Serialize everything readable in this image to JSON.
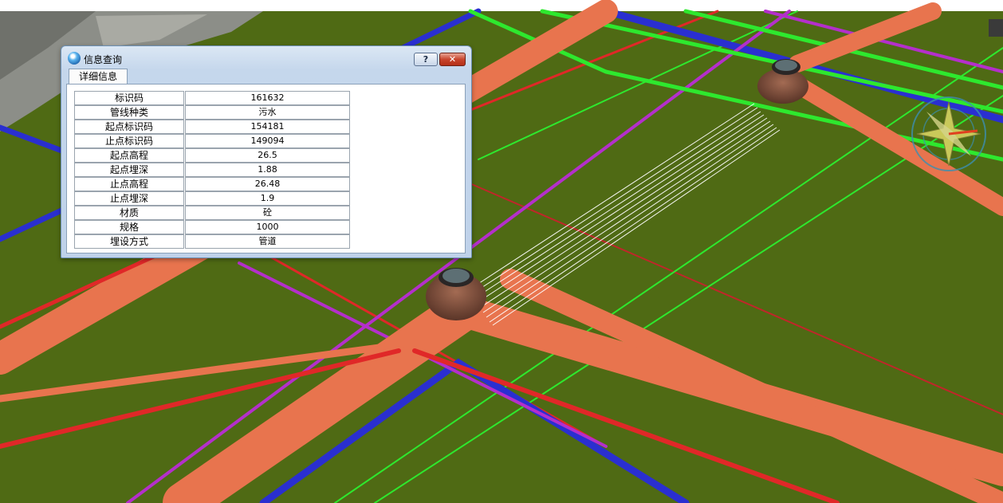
{
  "dialog": {
    "title": "信息查询",
    "help_label": "?",
    "close_label": "✕",
    "tab_label": "详细信息",
    "rows": [
      {
        "key": "标识码",
        "value": "161632"
      },
      {
        "key": "管线种类",
        "value": "污水"
      },
      {
        "key": "起点标识码",
        "value": "154181"
      },
      {
        "key": "止点标识码",
        "value": "149094"
      },
      {
        "key": "起点高程",
        "value": "26.5"
      },
      {
        "key": "起点埋深",
        "value": "1.88"
      },
      {
        "key": "止点高程",
        "value": "26.48"
      },
      {
        "key": "止点埋深",
        "value": "1.9"
      },
      {
        "key": "材质",
        "value": "砼"
      },
      {
        "key": "规格",
        "value": "1000"
      },
      {
        "key": "埋设方式",
        "value": "管道"
      }
    ]
  },
  "scene": {
    "ground_color": "#4f6a14",
    "pipe_colors": {
      "sewer": "#e8744e",
      "water": "#2a2fd0",
      "gas": "#b42fcb",
      "power": "#2ee82e",
      "telecom": "#e02828"
    },
    "compass_icon": "compass-rose-icon",
    "manhole_icon": "manhole-icon"
  }
}
